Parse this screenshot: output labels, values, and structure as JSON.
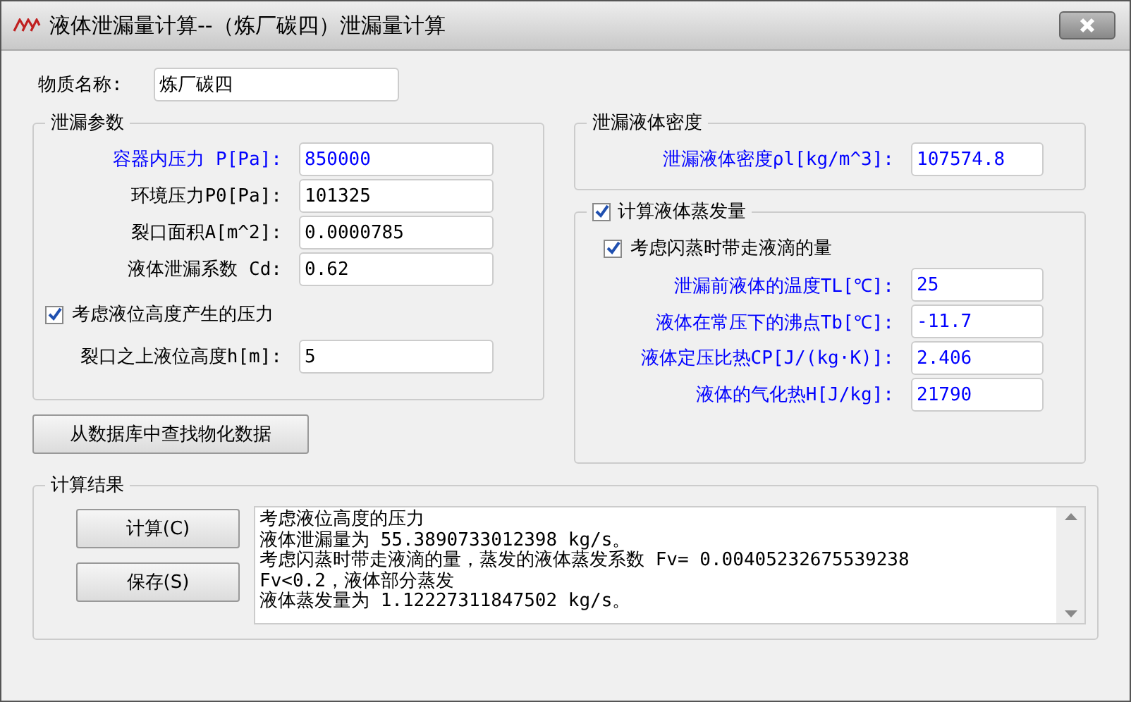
{
  "window": {
    "title": "液体泄漏量计算--（炼厂碳四）泄漏量计算"
  },
  "substance": {
    "label": "物质名称:",
    "value": "炼厂碳四"
  },
  "leak_params": {
    "title": "泄漏参数",
    "fields": [
      {
        "label": "容器内压力 P[Pa]:",
        "value": "850000",
        "highlighted": true
      },
      {
        "label": "环境压力P0[Pa]:",
        "value": "101325",
        "highlighted": false
      },
      {
        "label": "裂口面积A[m^2]:",
        "value": "0.0000785",
        "highlighted": false
      },
      {
        "label": "液体泄漏系数  Cd:",
        "value": "0.62",
        "highlighted": false
      }
    ],
    "height_checkbox": {
      "label": "考虑液位高度产生的压力",
      "checked": true
    },
    "height_field": {
      "label": "裂口之上液位高度h[m]:",
      "value": "5",
      "highlighted": false
    }
  },
  "lookup_button": "从数据库中查找物化数据",
  "density": {
    "title": "泄漏液体密度",
    "fields": [
      {
        "label": "泄漏液体密度ρl[kg/m^3]:",
        "value": "107574.8",
        "highlighted": true
      }
    ]
  },
  "evaporation": {
    "title": "计算液体蒸发量",
    "checked": true,
    "droplet_checkbox": {
      "label": "考虑闪蒸时带走液滴的量",
      "checked": true
    },
    "fields": [
      {
        "label": "泄漏前液体的温度TL[℃]:",
        "value": "25",
        "highlighted": true
      },
      {
        "label": "液体在常压下的沸点Tb[℃]:",
        "value": "-11.7",
        "highlighted": true
      },
      {
        "label": "液体定压比热CP[J/(kg·K)]:",
        "value": "2.406",
        "highlighted": true
      },
      {
        "label": "液体的气化热H[J/kg]:",
        "value": "21790",
        "highlighted": true
      }
    ]
  },
  "results": {
    "title": "计算结果",
    "buttons": [
      "计算(C)",
      "保存(S)"
    ],
    "lines": [
      "考虑液位高度的压力",
      "液体泄漏量为 55.3890733012398 kg/s。",
      "考虑闪蒸时带走液滴的量，蒸发的液体蒸发系数 Fv= 0.00405232675539238",
      "Fv<0.2，液体部分蒸发",
      "液体蒸发量为 1.12227311847502 kg/s。"
    ]
  }
}
